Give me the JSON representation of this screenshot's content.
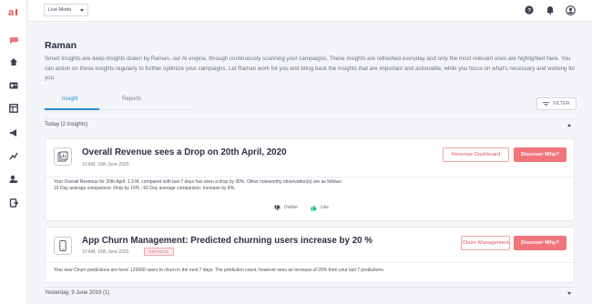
{
  "header": {
    "mode_selector": "Live Mode"
  },
  "page": {
    "title": "Raman",
    "description": "Smart Insights are deep insights drawn by Raman, our AI engine, through continuously scanning your campaigns. These insights are refreshed everyday and only the most relevant ones are highlighted here. You can action on these insights regularly to further optimize your campaigns. Let Raman work for you and bring back the insights that are important and actionable, while you focus on what's necessary and working for you."
  },
  "tabs": [
    {
      "label": "Insight",
      "active": true
    },
    {
      "label": "Reports",
      "active": false
    }
  ],
  "filter": {
    "label": "FILTER"
  },
  "sections": {
    "today": {
      "label": "Today (2 Insights)"
    },
    "yesterday": {
      "label": "Yesterday, 9 June 2019 (1)"
    }
  },
  "insights": [
    {
      "icon": "document-chart-icon",
      "title": "Overall Revenue sees a Drop on 20th April, 2020",
      "meta": "10 AM, 10th June 2020",
      "secondary_action": "Revenue Dashboard",
      "primary_action": "Discover Why?",
      "body_line1": "Your Overall Revenue for 20th April: 1.3 M, compared with last 7 days has seen a drop by 30%. Other noteworthy observation(s) are as follows:",
      "body_line2": "15 Day average comparison: Drop by 15% ; 60 Day average comparison: Increase by 8%."
    },
    {
      "icon": "mobile-icon",
      "title": "App Churn Management: Predicted churning users increase by 20 %",
      "meta": "10 AM, 10th June 2020",
      "badge": "CRITICAL",
      "secondary_action": "Churn Management",
      "primary_action": "Discover Why?",
      "body_line1": "Your new Churn predictions are here! 120000 users to churn in the next 7 days. The prediction count, however sees an increase of 20% from your last 7 predictions."
    }
  ],
  "reactions": {
    "dislike": "Dislike",
    "like": "Like"
  },
  "colors": {
    "brand": "#e8524a",
    "accent": "#1f8fd6",
    "primary_button": "#f0757b",
    "like": "#2bb39a"
  }
}
